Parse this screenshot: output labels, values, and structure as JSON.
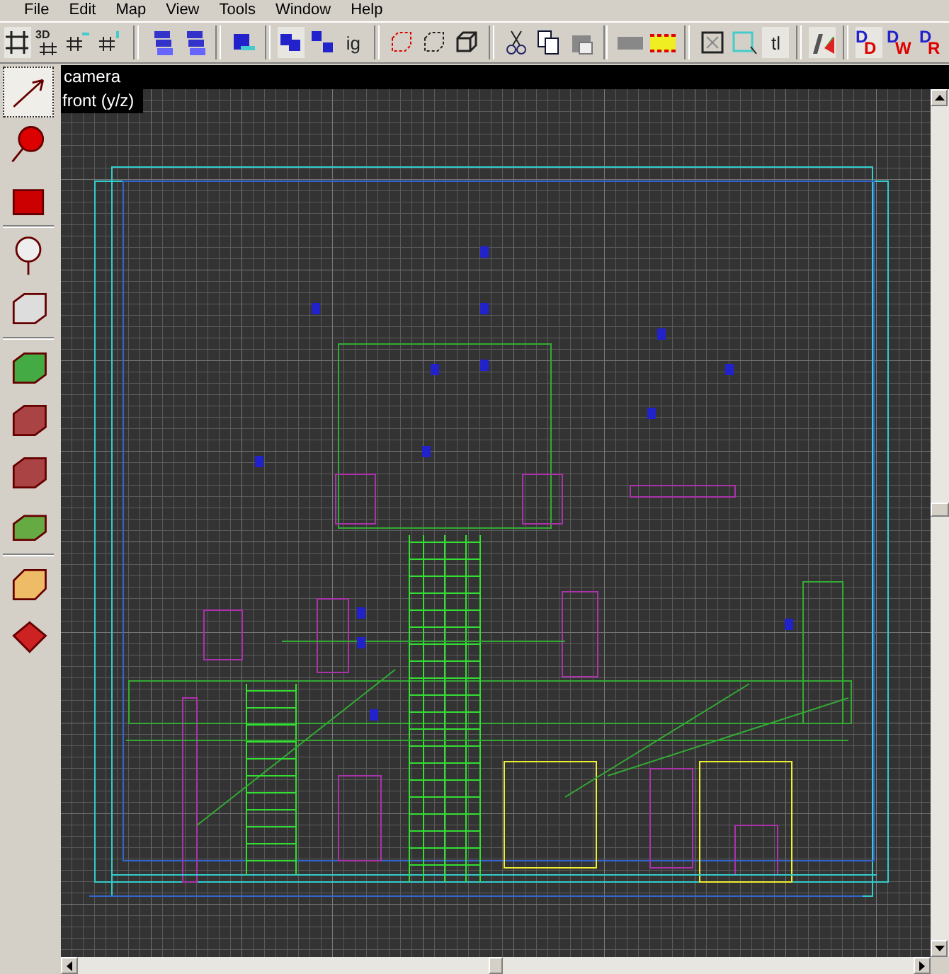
{
  "menu": [
    {
      "label": "File"
    },
    {
      "label": "Edit"
    },
    {
      "label": "Map"
    },
    {
      "label": "View"
    },
    {
      "label": "Tools"
    },
    {
      "label": "Window"
    },
    {
      "label": "Help"
    }
  ],
  "toolbar": [
    {
      "kind": "icon",
      "pressed": true
    },
    {
      "kind": "labeled",
      "label": "3D",
      "pressed": false
    },
    {
      "kind": "icon",
      "pressed": false
    },
    {
      "kind": "icon",
      "pressed": false
    },
    {
      "kind": "separator"
    },
    {
      "kind": "icon",
      "pressed": false
    },
    {
      "kind": "icon",
      "pressed": false
    },
    {
      "kind": "separator"
    },
    {
      "kind": "icon",
      "pressed": false
    },
    {
      "kind": "separator"
    },
    {
      "kind": "icon",
      "pressed": true
    },
    {
      "kind": "icon",
      "pressed": false
    },
    {
      "kind": "text",
      "label": "ig",
      "pressed": false
    },
    {
      "kind": "separator"
    },
    {
      "kind": "icon",
      "pressed": false
    },
    {
      "kind": "icon",
      "pressed": false
    },
    {
      "kind": "icon",
      "pressed": false
    },
    {
      "kind": "separator"
    },
    {
      "kind": "icon",
      "pressed": false
    },
    {
      "kind": "icon",
      "pressed": false
    },
    {
      "kind": "icon",
      "pressed": false
    },
    {
      "kind": "separator"
    },
    {
      "kind": "icon",
      "pressed": false
    },
    {
      "kind": "icon",
      "pressed": false
    },
    {
      "kind": "separator"
    },
    {
      "kind": "icon",
      "pressed": false
    },
    {
      "kind": "icon",
      "pressed": false
    },
    {
      "kind": "text",
      "label": "tl",
      "pressed": true
    },
    {
      "kind": "separator"
    },
    {
      "kind": "icon",
      "pressed": true
    },
    {
      "kind": "separator"
    },
    {
      "kind": "letters",
      "top": "D",
      "bottom": "D",
      "pressed": true
    },
    {
      "kind": "letters",
      "top": "D",
      "bottom": "W",
      "pressed": false
    },
    {
      "kind": "letters",
      "top": "D",
      "bottom": "R",
      "pressed": false
    }
  ],
  "side_tools": [
    {
      "selected": true
    },
    {
      "selected": false
    },
    {
      "selected": false
    },
    {
      "kind": "separator"
    },
    {
      "selected": false
    },
    {
      "selected": false
    },
    {
      "kind": "separator"
    },
    {
      "selected": false
    },
    {
      "selected": false
    },
    {
      "selected": false
    },
    {
      "selected": false
    },
    {
      "kind": "separator"
    },
    {
      "selected": false
    },
    {
      "selected": false
    }
  ],
  "camera": {
    "title": "camera"
  },
  "view": {
    "title": "front (y/z)"
  }
}
